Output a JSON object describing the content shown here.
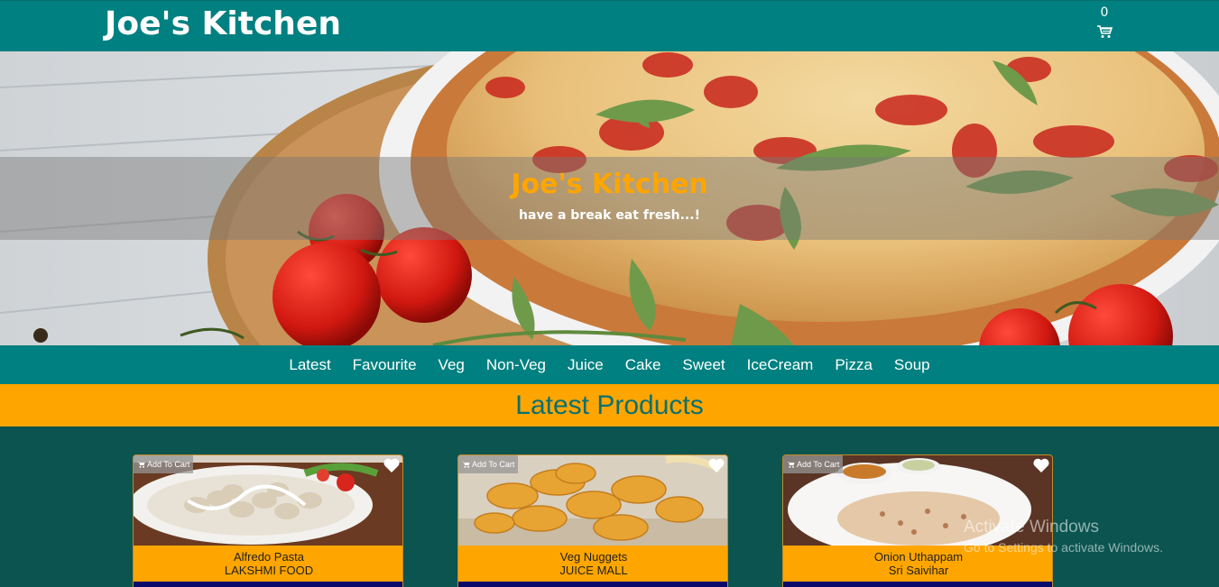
{
  "header": {
    "brand": "Joe's Kitchen",
    "cart_count": "0",
    "cart_icon": "cart-icon"
  },
  "hero": {
    "title": "Joe's Kitchen",
    "tagline": "have a break eat fresh...!"
  },
  "nav": {
    "items": [
      "Latest",
      "Favourite",
      "Veg",
      "Non-Veg",
      "Juice",
      "Cake",
      "Sweet",
      "IceCream",
      "Pizza",
      "Soup"
    ]
  },
  "section": {
    "title": "Latest Products"
  },
  "products": [
    {
      "add_label": "Add To Cart",
      "name": "Alfredo Pasta",
      "store": "LAKSHMI FOOD"
    },
    {
      "add_label": "Add To Cart",
      "name": "Veg Nuggets",
      "store": "JUICE MALL"
    },
    {
      "add_label": "Add To Cart",
      "name": "Onion Uthappam",
      "store": "Sri Saivihar"
    }
  ],
  "watermark": {
    "line1": "Activate Windows",
    "line2": "Go to Settings to activate Windows."
  },
  "colors": {
    "teal": "#008080",
    "orange": "#ffa500",
    "dark_teal": "#0b5450",
    "navy": "#0a0a6a"
  }
}
